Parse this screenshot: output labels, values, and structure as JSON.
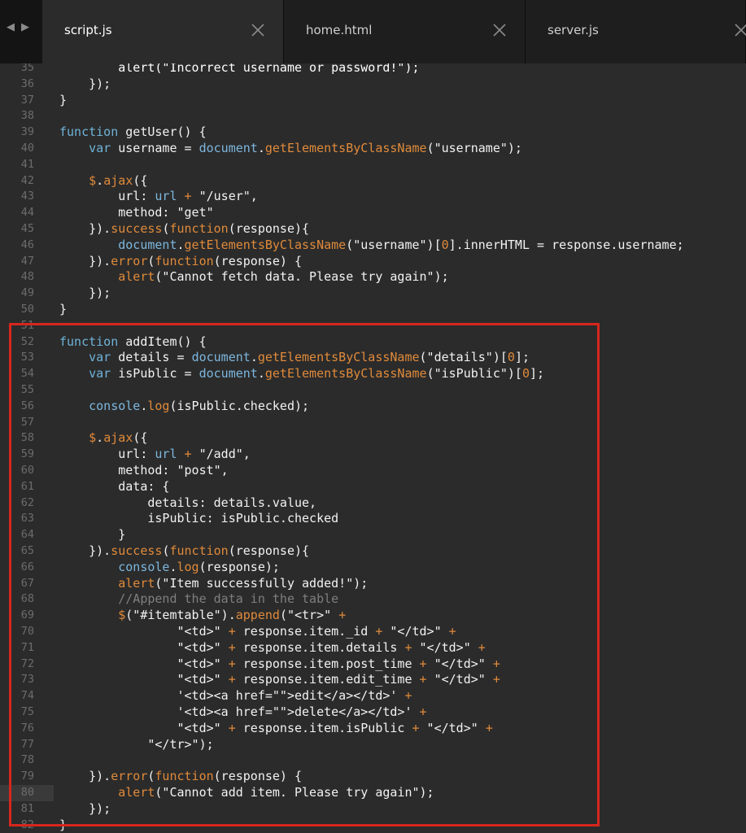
{
  "tabs": [
    {
      "label": "script.js",
      "active": true
    },
    {
      "label": "home.html",
      "active": false
    },
    {
      "label": "server.js",
      "active": false
    }
  ],
  "editor": {
    "lines": [
      {
        "num": "35",
        "tokens": [
          [
            "        ",
            "p"
          ],
          [
            "alert(\"Incorrect username or password!\");",
            "s"
          ]
        ]
      },
      {
        "num": "36",
        "tokens": [
          [
            "    });",
            "p"
          ]
        ]
      },
      {
        "num": "37",
        "tokens": [
          [
            "}",
            "p"
          ]
        ]
      },
      {
        "num": "38",
        "tokens": []
      },
      {
        "num": "39",
        "tokens": [
          [
            "function",
            "k"
          ],
          [
            " getUser() {",
            "p"
          ]
        ]
      },
      {
        "num": "40",
        "tokens": [
          [
            "    ",
            "p"
          ],
          [
            "var",
            "k"
          ],
          [
            " username = ",
            "p"
          ],
          [
            "document",
            "obj"
          ],
          [
            ".",
            "p"
          ],
          [
            "getElementsByClassName",
            "mth"
          ],
          [
            "(\"username\");",
            "p"
          ]
        ]
      },
      {
        "num": "41",
        "tokens": []
      },
      {
        "num": "42",
        "tokens": [
          [
            "    ",
            "p"
          ],
          [
            "$",
            "mth"
          ],
          [
            ".",
            "p"
          ],
          [
            "ajax",
            "mth"
          ],
          [
            "({",
            "p"
          ]
        ]
      },
      {
        "num": "43",
        "tokens": [
          [
            "        url: ",
            "p"
          ],
          [
            "url",
            "obj"
          ],
          [
            " + ",
            "op"
          ],
          [
            "\"/user\",",
            "p"
          ]
        ]
      },
      {
        "num": "44",
        "tokens": [
          [
            "        method: \"get\"",
            "p"
          ]
        ]
      },
      {
        "num": "45",
        "tokens": [
          [
            "    }).",
            "p"
          ],
          [
            "success",
            "mth"
          ],
          [
            "(",
            "p"
          ],
          [
            "function",
            "kw2"
          ],
          [
            "(response){",
            "p"
          ]
        ]
      },
      {
        "num": "46",
        "tokens": [
          [
            "        ",
            "p"
          ],
          [
            "document",
            "obj"
          ],
          [
            ".",
            "p"
          ],
          [
            "getElementsByClassName",
            "mth"
          ],
          [
            "(\"username\")[",
            "p"
          ],
          [
            "0",
            "num"
          ],
          [
            "].innerHTML = response.username;",
            "p"
          ]
        ]
      },
      {
        "num": "47",
        "tokens": [
          [
            "    }).",
            "p"
          ],
          [
            "error",
            "mth"
          ],
          [
            "(",
            "p"
          ],
          [
            "function",
            "kw2"
          ],
          [
            "(response) {",
            "p"
          ]
        ]
      },
      {
        "num": "48",
        "tokens": [
          [
            "        ",
            "p"
          ],
          [
            "alert",
            "mth"
          ],
          [
            "(\"Cannot fetch data. Please try again\");",
            "p"
          ]
        ]
      },
      {
        "num": "49",
        "tokens": [
          [
            "    });",
            "p"
          ]
        ]
      },
      {
        "num": "50",
        "tokens": [
          [
            "}",
            "p"
          ]
        ]
      },
      {
        "num": "51",
        "tokens": []
      },
      {
        "num": "52",
        "tokens": [
          [
            "function",
            "k"
          ],
          [
            " addItem() {",
            "p"
          ]
        ]
      },
      {
        "num": "53",
        "tokens": [
          [
            "    ",
            "p"
          ],
          [
            "var",
            "k"
          ],
          [
            " details = ",
            "p"
          ],
          [
            "document",
            "obj"
          ],
          [
            ".",
            "p"
          ],
          [
            "getElementsByClassName",
            "mth"
          ],
          [
            "(\"details\")[",
            "p"
          ],
          [
            "0",
            "num"
          ],
          [
            "];",
            "p"
          ]
        ]
      },
      {
        "num": "54",
        "tokens": [
          [
            "    ",
            "p"
          ],
          [
            "var",
            "k"
          ],
          [
            " isPublic = ",
            "p"
          ],
          [
            "document",
            "obj"
          ],
          [
            ".",
            "p"
          ],
          [
            "getElementsByClassName",
            "mth"
          ],
          [
            "(\"isPublic\")[",
            "p"
          ],
          [
            "0",
            "num"
          ],
          [
            "];",
            "p"
          ]
        ]
      },
      {
        "num": "55",
        "tokens": []
      },
      {
        "num": "56",
        "tokens": [
          [
            "    ",
            "p"
          ],
          [
            "console",
            "obj"
          ],
          [
            ".",
            "p"
          ],
          [
            "log",
            "mth"
          ],
          [
            "(isPublic.checked);",
            "p"
          ]
        ]
      },
      {
        "num": "57",
        "tokens": []
      },
      {
        "num": "58",
        "tokens": [
          [
            "    ",
            "p"
          ],
          [
            "$",
            "mth"
          ],
          [
            ".",
            "p"
          ],
          [
            "ajax",
            "mth"
          ],
          [
            "({",
            "p"
          ]
        ]
      },
      {
        "num": "59",
        "tokens": [
          [
            "        url: ",
            "p"
          ],
          [
            "url",
            "obj"
          ],
          [
            " + ",
            "op"
          ],
          [
            "\"/add\",",
            "p"
          ]
        ]
      },
      {
        "num": "60",
        "tokens": [
          [
            "        method: \"post\",",
            "p"
          ]
        ]
      },
      {
        "num": "61",
        "tokens": [
          [
            "        data: {",
            "p"
          ]
        ]
      },
      {
        "num": "62",
        "tokens": [
          [
            "            details: details.value,",
            "p"
          ]
        ]
      },
      {
        "num": "63",
        "tokens": [
          [
            "            isPublic: isPublic.checked",
            "p"
          ]
        ]
      },
      {
        "num": "64",
        "tokens": [
          [
            "        }",
            "p"
          ]
        ]
      },
      {
        "num": "65",
        "tokens": [
          [
            "    }).",
            "p"
          ],
          [
            "success",
            "mth"
          ],
          [
            "(",
            "p"
          ],
          [
            "function",
            "kw2"
          ],
          [
            "(response){",
            "p"
          ]
        ]
      },
      {
        "num": "66",
        "tokens": [
          [
            "        ",
            "p"
          ],
          [
            "console",
            "obj"
          ],
          [
            ".",
            "p"
          ],
          [
            "log",
            "mth"
          ],
          [
            "(response);",
            "p"
          ]
        ]
      },
      {
        "num": "67",
        "tokens": [
          [
            "        ",
            "p"
          ],
          [
            "alert",
            "mth"
          ],
          [
            "(\"Item successfully added!\");",
            "p"
          ]
        ]
      },
      {
        "num": "68",
        "tokens": [
          [
            "        //Append the data in the table",
            "cm"
          ]
        ]
      },
      {
        "num": "69",
        "tokens": [
          [
            "        ",
            "p"
          ],
          [
            "$",
            "mth"
          ],
          [
            "(\"#itemtable\").",
            "p"
          ],
          [
            "append",
            "mth"
          ],
          [
            "(\"<tr>\" ",
            "p"
          ],
          [
            "+",
            "op"
          ]
        ]
      },
      {
        "num": "70",
        "tokens": [
          [
            "                \"<td>\" ",
            "p"
          ],
          [
            "+",
            "op"
          ],
          [
            " response.item._id ",
            "p"
          ],
          [
            "+",
            "op"
          ],
          [
            " \"</td>\" ",
            "p"
          ],
          [
            "+",
            "op"
          ]
        ]
      },
      {
        "num": "71",
        "tokens": [
          [
            "                \"<td>\" ",
            "p"
          ],
          [
            "+",
            "op"
          ],
          [
            " response.item.details ",
            "p"
          ],
          [
            "+",
            "op"
          ],
          [
            " \"</td>\" ",
            "p"
          ],
          [
            "+",
            "op"
          ]
        ]
      },
      {
        "num": "72",
        "tokens": [
          [
            "                \"<td>\" ",
            "p"
          ],
          [
            "+",
            "op"
          ],
          [
            " response.item.post_time ",
            "p"
          ],
          [
            "+",
            "op"
          ],
          [
            " \"</td>\" ",
            "p"
          ],
          [
            "+",
            "op"
          ]
        ]
      },
      {
        "num": "73",
        "tokens": [
          [
            "                \"<td>\" ",
            "p"
          ],
          [
            "+",
            "op"
          ],
          [
            " response.item.edit_time ",
            "p"
          ],
          [
            "+",
            "op"
          ],
          [
            " \"</td>\" ",
            "p"
          ],
          [
            "+",
            "op"
          ]
        ]
      },
      {
        "num": "74",
        "tokens": [
          [
            "                '<td><a href=\"\">edit</a></td>' ",
            "p"
          ],
          [
            "+",
            "op"
          ]
        ]
      },
      {
        "num": "75",
        "tokens": [
          [
            "                '<td><a href=\"\">delete</a></td>' ",
            "p"
          ],
          [
            "+",
            "op"
          ]
        ]
      },
      {
        "num": "76",
        "tokens": [
          [
            "                \"<td>\" ",
            "p"
          ],
          [
            "+",
            "op"
          ],
          [
            " response.item.isPublic ",
            "p"
          ],
          [
            "+",
            "op"
          ],
          [
            " \"</td>\" ",
            "p"
          ],
          [
            "+",
            "op"
          ]
        ]
      },
      {
        "num": "77",
        "tokens": [
          [
            "            \"</tr>\");",
            "p"
          ]
        ]
      },
      {
        "num": "78",
        "tokens": []
      },
      {
        "num": "79",
        "tokens": [
          [
            "    }).",
            "p"
          ],
          [
            "error",
            "mth"
          ],
          [
            "(",
            "p"
          ],
          [
            "function",
            "kw2"
          ],
          [
            "(response) {",
            "p"
          ]
        ]
      },
      {
        "num": "80",
        "tokens": [
          [
            "        ",
            "p"
          ],
          [
            "alert",
            "mth"
          ],
          [
            "(\"Cannot add item. Please try again\");",
            "p"
          ]
        ]
      },
      {
        "num": "81",
        "tokens": [
          [
            "    });",
            "p"
          ]
        ]
      },
      {
        "num": "82",
        "tokens": [
          [
            "}",
            "p"
          ]
        ]
      }
    ]
  }
}
